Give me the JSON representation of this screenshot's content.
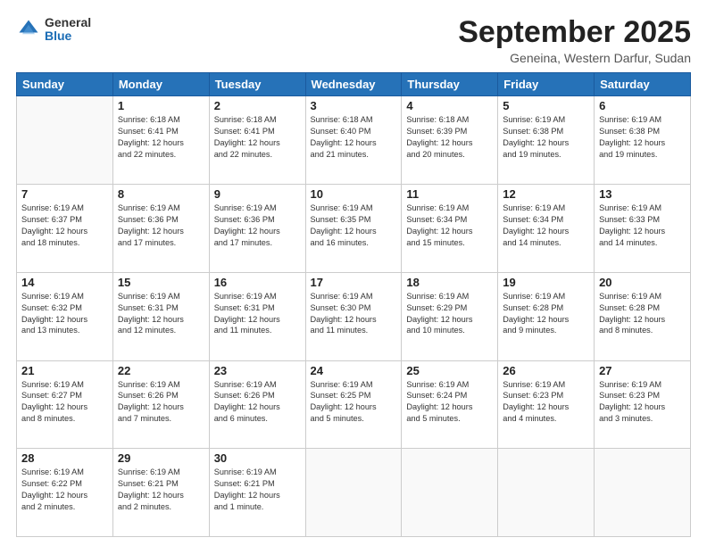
{
  "header": {
    "logo": {
      "general": "General",
      "blue": "Blue"
    },
    "title": "September 2025",
    "location": "Geneina, Western Darfur, Sudan"
  },
  "days_of_week": [
    "Sunday",
    "Monday",
    "Tuesday",
    "Wednesday",
    "Thursday",
    "Friday",
    "Saturday"
  ],
  "weeks": [
    [
      {
        "day": "",
        "info": ""
      },
      {
        "day": "1",
        "info": "Sunrise: 6:18 AM\nSunset: 6:41 PM\nDaylight: 12 hours\nand 22 minutes."
      },
      {
        "day": "2",
        "info": "Sunrise: 6:18 AM\nSunset: 6:41 PM\nDaylight: 12 hours\nand 22 minutes."
      },
      {
        "day": "3",
        "info": "Sunrise: 6:18 AM\nSunset: 6:40 PM\nDaylight: 12 hours\nand 21 minutes."
      },
      {
        "day": "4",
        "info": "Sunrise: 6:18 AM\nSunset: 6:39 PM\nDaylight: 12 hours\nand 20 minutes."
      },
      {
        "day": "5",
        "info": "Sunrise: 6:19 AM\nSunset: 6:38 PM\nDaylight: 12 hours\nand 19 minutes."
      },
      {
        "day": "6",
        "info": "Sunrise: 6:19 AM\nSunset: 6:38 PM\nDaylight: 12 hours\nand 19 minutes."
      }
    ],
    [
      {
        "day": "7",
        "info": "Sunrise: 6:19 AM\nSunset: 6:37 PM\nDaylight: 12 hours\nand 18 minutes."
      },
      {
        "day": "8",
        "info": "Sunrise: 6:19 AM\nSunset: 6:36 PM\nDaylight: 12 hours\nand 17 minutes."
      },
      {
        "day": "9",
        "info": "Sunrise: 6:19 AM\nSunset: 6:36 PM\nDaylight: 12 hours\nand 17 minutes."
      },
      {
        "day": "10",
        "info": "Sunrise: 6:19 AM\nSunset: 6:35 PM\nDaylight: 12 hours\nand 16 minutes."
      },
      {
        "day": "11",
        "info": "Sunrise: 6:19 AM\nSunset: 6:34 PM\nDaylight: 12 hours\nand 15 minutes."
      },
      {
        "day": "12",
        "info": "Sunrise: 6:19 AM\nSunset: 6:34 PM\nDaylight: 12 hours\nand 14 minutes."
      },
      {
        "day": "13",
        "info": "Sunrise: 6:19 AM\nSunset: 6:33 PM\nDaylight: 12 hours\nand 14 minutes."
      }
    ],
    [
      {
        "day": "14",
        "info": "Sunrise: 6:19 AM\nSunset: 6:32 PM\nDaylight: 12 hours\nand 13 minutes."
      },
      {
        "day": "15",
        "info": "Sunrise: 6:19 AM\nSunset: 6:31 PM\nDaylight: 12 hours\nand 12 minutes."
      },
      {
        "day": "16",
        "info": "Sunrise: 6:19 AM\nSunset: 6:31 PM\nDaylight: 12 hours\nand 11 minutes."
      },
      {
        "day": "17",
        "info": "Sunrise: 6:19 AM\nSunset: 6:30 PM\nDaylight: 12 hours\nand 11 minutes."
      },
      {
        "day": "18",
        "info": "Sunrise: 6:19 AM\nSunset: 6:29 PM\nDaylight: 12 hours\nand 10 minutes."
      },
      {
        "day": "19",
        "info": "Sunrise: 6:19 AM\nSunset: 6:28 PM\nDaylight: 12 hours\nand 9 minutes."
      },
      {
        "day": "20",
        "info": "Sunrise: 6:19 AM\nSunset: 6:28 PM\nDaylight: 12 hours\nand 8 minutes."
      }
    ],
    [
      {
        "day": "21",
        "info": "Sunrise: 6:19 AM\nSunset: 6:27 PM\nDaylight: 12 hours\nand 8 minutes."
      },
      {
        "day": "22",
        "info": "Sunrise: 6:19 AM\nSunset: 6:26 PM\nDaylight: 12 hours\nand 7 minutes."
      },
      {
        "day": "23",
        "info": "Sunrise: 6:19 AM\nSunset: 6:26 PM\nDaylight: 12 hours\nand 6 minutes."
      },
      {
        "day": "24",
        "info": "Sunrise: 6:19 AM\nSunset: 6:25 PM\nDaylight: 12 hours\nand 5 minutes."
      },
      {
        "day": "25",
        "info": "Sunrise: 6:19 AM\nSunset: 6:24 PM\nDaylight: 12 hours\nand 5 minutes."
      },
      {
        "day": "26",
        "info": "Sunrise: 6:19 AM\nSunset: 6:23 PM\nDaylight: 12 hours\nand 4 minutes."
      },
      {
        "day": "27",
        "info": "Sunrise: 6:19 AM\nSunset: 6:23 PM\nDaylight: 12 hours\nand 3 minutes."
      }
    ],
    [
      {
        "day": "28",
        "info": "Sunrise: 6:19 AM\nSunset: 6:22 PM\nDaylight: 12 hours\nand 2 minutes."
      },
      {
        "day": "29",
        "info": "Sunrise: 6:19 AM\nSunset: 6:21 PM\nDaylight: 12 hours\nand 2 minutes."
      },
      {
        "day": "30",
        "info": "Sunrise: 6:19 AM\nSunset: 6:21 PM\nDaylight: 12 hours\nand 1 minute."
      },
      {
        "day": "",
        "info": ""
      },
      {
        "day": "",
        "info": ""
      },
      {
        "day": "",
        "info": ""
      },
      {
        "day": "",
        "info": ""
      }
    ]
  ]
}
